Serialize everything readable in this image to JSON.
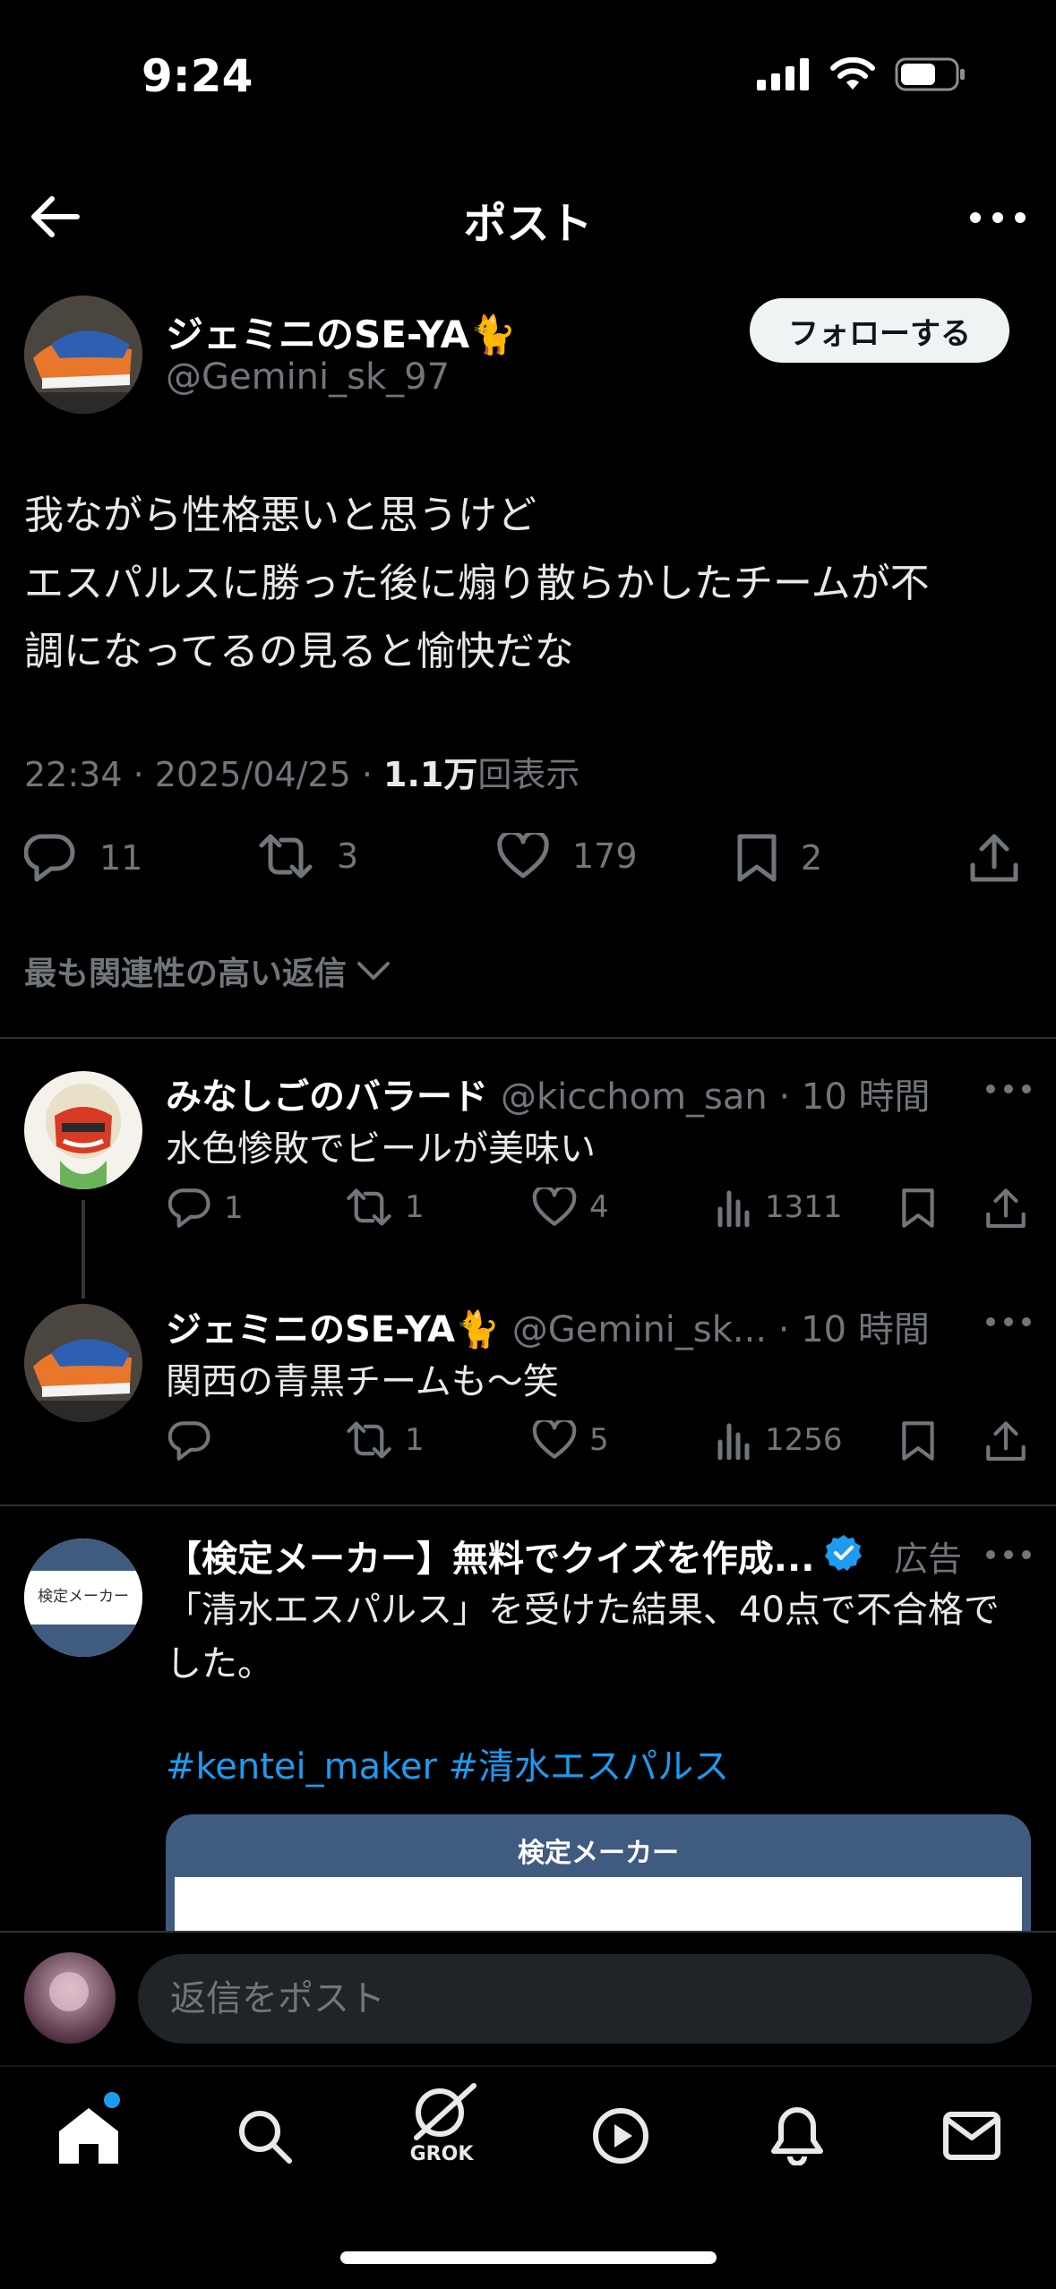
{
  "status_bar": {
    "time": "9:24"
  },
  "header": {
    "title": "ポスト"
  },
  "post": {
    "author_name": "ジェミニのSE-YA🐈",
    "handle": "@Gemini_sk_97",
    "follow_label": "フォローする",
    "text_lines": [
      "我ながら性格悪いと思うけど",
      "エスパルスに勝った後に煽り散らかしたチームが不",
      "調になってるの見ると愉快だな"
    ],
    "time": "22:34",
    "date": "2025/04/25",
    "views_count": "1.1万",
    "views_label": "回表示",
    "stats": {
      "replies": "11",
      "reposts": "3",
      "likes": "179",
      "bookmarks": "2"
    }
  },
  "sort_label": "最も関連性の高い返信",
  "replies": [
    {
      "name": "みなしごのバラード",
      "handle": "@kicchom_san",
      "time": "10 時間",
      "text": "水色惨敗でビールが美味い",
      "replies": "1",
      "reposts": "1",
      "likes": "4",
      "views": "1311"
    },
    {
      "name": "ジェミニのSE-YA🐈",
      "handle": "@Gemini_sk...",
      "time": "10 時間",
      "text": "関西の青黒チームも〜笑",
      "replies": "",
      "reposts": "1",
      "likes": "5",
      "views": "1256"
    }
  ],
  "ad": {
    "title": "【検定メーカー】無料でクイズを作成...",
    "label": "広告",
    "avatar_text": "検定メーカー",
    "text": "「清水エスパルス」を受けた結果、40点で不合格でした。",
    "hashtags": "#kentei_maker #清水エスパルス",
    "card_title": "検定メーカー"
  },
  "composer": {
    "placeholder": "返信をポスト"
  },
  "tabbar": {
    "grok_label": "GROK"
  },
  "colors": {
    "accent": "#1d9bf0",
    "muted": "#71767b",
    "background": "#000000"
  }
}
